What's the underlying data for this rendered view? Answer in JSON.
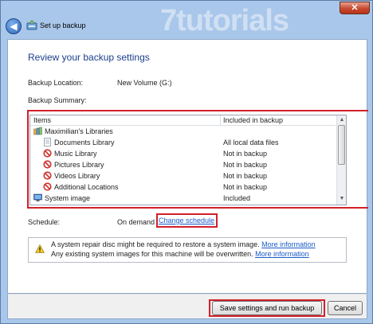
{
  "window": {
    "title": "Set up backup",
    "watermark": "7tutorials",
    "close_glyph": "✕",
    "back_glyph": "◀"
  },
  "page": {
    "heading": "Review your backup settings",
    "backup_location_label": "Backup Location:",
    "backup_location_value": "New Volume (G:)",
    "backup_summary_label": "Backup Summary:"
  },
  "table": {
    "headers": [
      "Items",
      "Included in backup"
    ],
    "rows": [
      {
        "icon": "libraries-icon",
        "name": "Maximilian's Libraries",
        "status": ""
      },
      {
        "icon": "library-icon",
        "name": "Documents Library",
        "status": "All local data files"
      },
      {
        "icon": "not-included-icon",
        "name": "Music Library",
        "status": "Not in backup"
      },
      {
        "icon": "not-included-icon",
        "name": "Pictures Library",
        "status": "Not in backup"
      },
      {
        "icon": "not-included-icon",
        "name": "Videos Library",
        "status": "Not in backup"
      },
      {
        "icon": "not-included-icon",
        "name": "Additional Locations",
        "status": "Not in backup"
      },
      {
        "icon": "system-image-icon",
        "name": "System image",
        "status": "Included"
      }
    ]
  },
  "schedule": {
    "label": "Schedule:",
    "value": "On demand",
    "change_link": "Change schedule"
  },
  "warning": {
    "line1": "A system repair disc might be required to restore a system image.",
    "line1_link": "More information",
    "line2": "Any existing system images for this machine will be overwritten.",
    "line2_link": "More information"
  },
  "buttons": {
    "save": "Save settings and run backup",
    "cancel": "Cancel"
  },
  "colors": {
    "highlight": "#d2202a",
    "link": "#1a5bc8",
    "heading": "#1a3e8c"
  }
}
